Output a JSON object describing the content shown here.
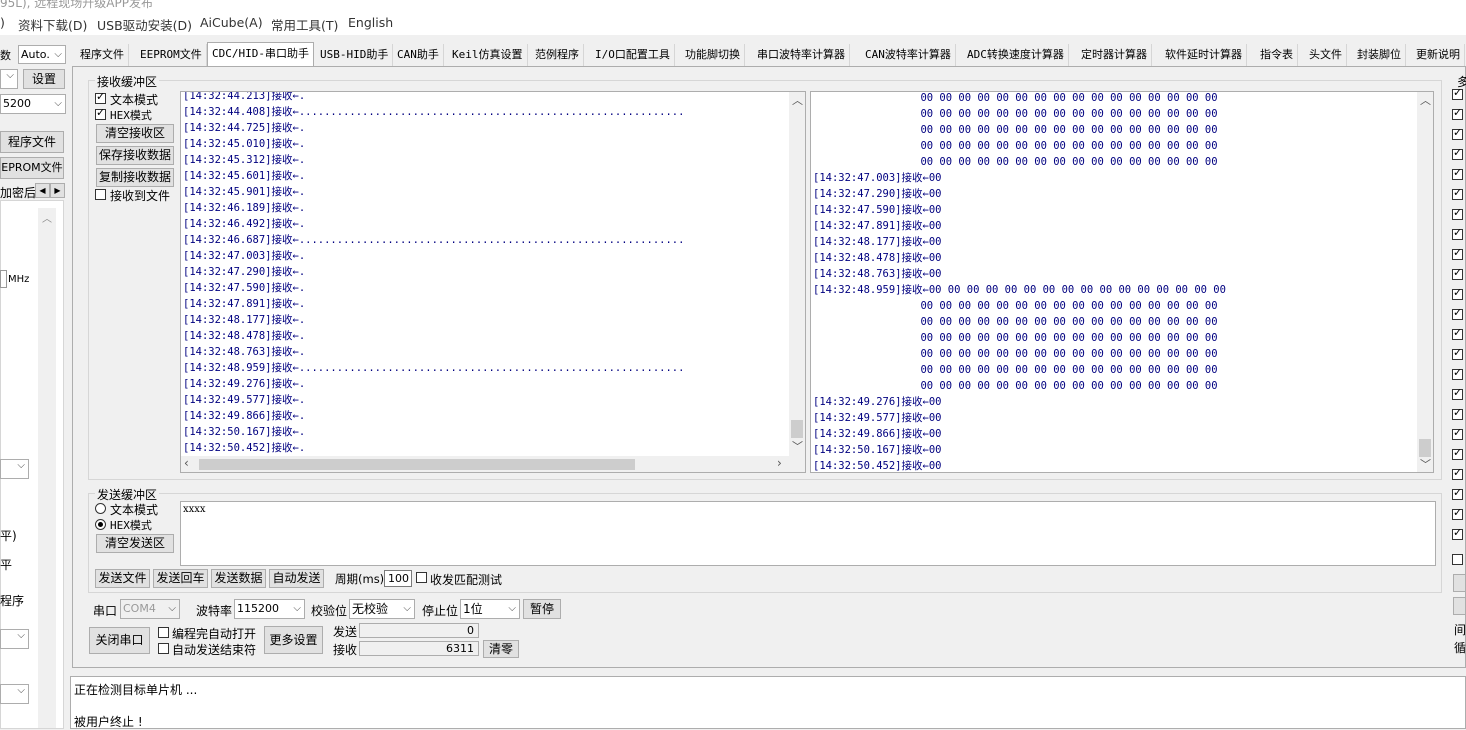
{
  "title_fragment": "95L), 远程现场升级APP发布",
  "menu": [
    "资料下载(D)",
    "USB驱动安装(D)",
    "AiCube(A)",
    "常用工具(T)",
    "English"
  ],
  "menu_prefix": ")",
  "left_panel": {
    "label_fragment": "数",
    "auto_select": "Auto.",
    "settings_button": "设置",
    "baud_fragment": "5200",
    "program_file_button": "程序文件",
    "eeprom_file_button": "EPROM文件",
    "encrypt_tab": "加密后",
    "mhz_unit": "MHz",
    "level_text_1": "平)",
    "level_text_2": "平",
    "program_text": "程序"
  },
  "tabs": [
    "程序文件",
    "EEPROM文件",
    "CDC/HID-串口助手",
    "USB-HID助手",
    "CAN助手",
    "Keil仿真设置",
    "范例程序",
    "I/O口配置工具",
    "功能脚切换",
    "串口波特率计算器",
    "CAN波特率计算器",
    "ADC转换速度计算器",
    "定时器计算器",
    "软件延时计算器",
    "指令表",
    "头文件",
    "封装脚位",
    "更新说明"
  ],
  "active_tab": "CDC/HID-串口助手",
  "receive": {
    "group_label": "接收缓冲区",
    "text_mode_label": "文本模式",
    "hex_mode_label": "HEX模式",
    "text_mode_checked": true,
    "hex_mode_checked": true,
    "clear_button": "清空接收区",
    "save_button": "保存接收数据",
    "copy_button": "复制接收数据",
    "to_file_label": "接收到文件",
    "left_lines": [
      "[14:32:44.213]接收←.",
      "[14:32:44.408]接收←.............................................................",
      "[14:32:44.725]接收←.",
      "[14:32:45.010]接收←.",
      "[14:32:45.312]接收←.",
      "[14:32:45.601]接收←.",
      "[14:32:45.901]接收←.",
      "[14:32:46.189]接收←.",
      "[14:32:46.492]接收←.",
      "[14:32:46.687]接收←.............................................................",
      "[14:32:47.003]接收←.",
      "[14:32:47.290]接收←.",
      "[14:32:47.590]接收←.",
      "[14:32:47.891]接收←.",
      "[14:32:48.177]接收←.",
      "[14:32:48.478]接收←.",
      "[14:32:48.763]接收←.",
      "[14:32:48.959]接收←.............................................................",
      "[14:32:49.276]接收←.",
      "[14:32:49.577]接收←.",
      "[14:32:49.866]接收←.",
      "[14:32:50.167]接收←.",
      "[14:32:50.452]接收←."
    ],
    "right_lines": [
      "                 00 00 00 00 00 00 00 00 00 00 00 00 00 00 00 00",
      "                 00 00 00 00 00 00 00 00 00 00 00 00 00 00 00 00",
      "                 00 00 00 00 00 00 00 00 00 00 00 00 00 00 00 00",
      "                 00 00 00 00 00 00 00 00 00 00 00 00 00 00 00 00",
      "                 00 00 00 00 00 00 00 00 00 00 00 00 00 00 00 00",
      "[14:32:47.003]接收←00",
      "[14:32:47.290]接收←00",
      "[14:32:47.590]接收←00",
      "[14:32:47.891]接收←00",
      "[14:32:48.177]接收←00",
      "[14:32:48.478]接收←00",
      "[14:32:48.763]接收←00",
      "[14:32:48.959]接收←00 00 00 00 00 00 00 00 00 00 00 00 00 00 00 00",
      "                 00 00 00 00 00 00 00 00 00 00 00 00 00 00 00 00",
      "                 00 00 00 00 00 00 00 00 00 00 00 00 00 00 00 00",
      "                 00 00 00 00 00 00 00 00 00 00 00 00 00 00 00 00",
      "                 00 00 00 00 00 00 00 00 00 00 00 00 00 00 00 00",
      "                 00 00 00 00 00 00 00 00 00 00 00 00 00 00 00 00",
      "                 00 00 00 00 00 00 00 00 00 00 00 00 00 00 00 00",
      "[14:32:49.276]接收←00",
      "[14:32:49.577]接收←00",
      "[14:32:49.866]接收←00",
      "[14:32:50.167]接收←00",
      "[14:32:50.452]接收←00"
    ]
  },
  "send": {
    "group_label": "发送缓冲区",
    "text_mode_label": "文本模式",
    "hex_mode_label": "HEX模式",
    "clear_button": "清空发送区",
    "content": "xxxx",
    "send_file_button": "发送文件",
    "send_return_button": "发送回车",
    "send_data_button": "发送数据",
    "auto_send_button": "自动发送",
    "period_label": "周期(ms)",
    "period_value": "100",
    "match_test_label": "收发匹配测试"
  },
  "port": {
    "port_label": "串口",
    "port_value": "COM4",
    "baud_label": "波特率",
    "baud_value": "115200",
    "parity_label": "校验位",
    "parity_value": "无校验",
    "stop_label": "停止位",
    "stop_value": "1位",
    "pause_button": "暂停",
    "close_button": "关闭串口",
    "auto_open_label": "编程完自动打开",
    "auto_end_label": "自动发送结束符",
    "more_settings_button": "更多设置",
    "send_label": "发送",
    "send_count": "0",
    "recv_label": "接收",
    "recv_count": "6311",
    "clear_count_button": "清零"
  },
  "log": {
    "line1": "正在检测目标单片机 ...",
    "line2": "被用户终止 !"
  },
  "right_edge": {
    "label_top": "多",
    "label_jian": "间",
    "label_xun": "循"
  }
}
